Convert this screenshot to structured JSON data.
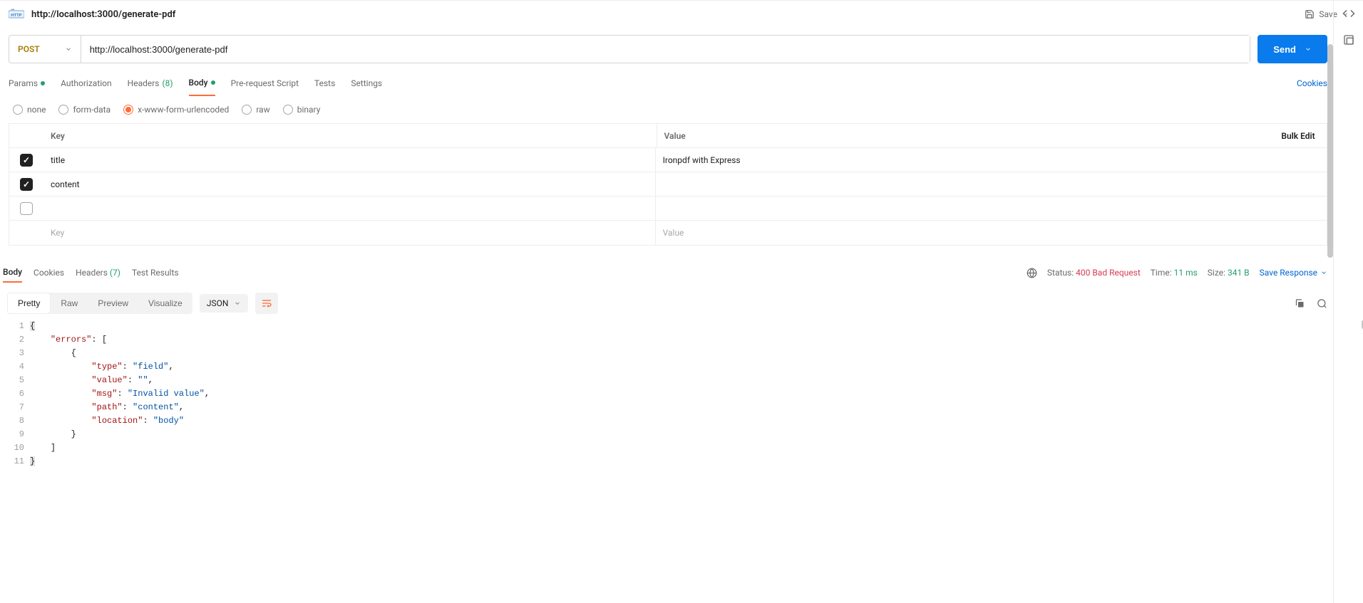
{
  "header": {
    "title": "http://localhost:3000/generate-pdf",
    "save_label": "Save"
  },
  "url_bar": {
    "method": "POST",
    "url": "http://localhost:3000/generate-pdf",
    "send_label": "Send"
  },
  "req_tabs": {
    "params": "Params",
    "authorization": "Authorization",
    "headers": "Headers",
    "headers_count": "(8)",
    "body": "Body",
    "prerequest": "Pre-request Script",
    "tests": "Tests",
    "settings": "Settings",
    "cookies": "Cookies"
  },
  "body_types": {
    "none": "none",
    "form_data": "form-data",
    "urlencoded": "x-www-form-urlencoded",
    "raw": "raw",
    "binary": "binary",
    "selected": "urlencoded"
  },
  "params_table": {
    "header_key": "Key",
    "header_value": "Value",
    "bulk_edit": "Bulk Edit",
    "rows": [
      {
        "checked": true,
        "key": "title",
        "value": "Ironpdf with Express"
      },
      {
        "checked": true,
        "key": "content",
        "value": ""
      },
      {
        "checked": false,
        "key": "",
        "value": ""
      }
    ],
    "placeholder_key": "Key",
    "placeholder_value": "Value"
  },
  "resp_tabs": {
    "body": "Body",
    "cookies": "Cookies",
    "headers": "Headers",
    "headers_count": "(7)",
    "test_results": "Test Results"
  },
  "resp_status": {
    "status_label": "Status:",
    "status_value": "400 Bad Request",
    "time_label": "Time:",
    "time_value": "11 ms",
    "size_label": "Size:",
    "size_value": "341 B",
    "save_response": "Save Response"
  },
  "resp_toolbar": {
    "pretty": "Pretty",
    "raw": "Raw",
    "preview": "Preview",
    "visualize": "Visualize",
    "format": "JSON"
  },
  "response_json": {
    "lines": [
      {
        "n": 1,
        "html": "<span class='hilite tok-punc'>{</span>"
      },
      {
        "n": 2,
        "html": "    <span class='tok-key'>\"errors\"</span><span class='tok-punc'>:</span> <span class='tok-punc'>[</span>"
      },
      {
        "n": 3,
        "html": "        <span class='tok-punc'>{</span>"
      },
      {
        "n": 4,
        "html": "            <span class='tok-key'>\"type\"</span><span class='tok-punc'>:</span> <span class='tok-str'>\"field\"</span><span class='tok-punc'>,</span>"
      },
      {
        "n": 5,
        "html": "            <span class='tok-key'>\"value\"</span><span class='tok-punc'>:</span> <span class='tok-str'>\"\"</span><span class='tok-punc'>,</span>"
      },
      {
        "n": 6,
        "html": "            <span class='tok-key'>\"msg\"</span><span class='tok-punc'>:</span> <span class='tok-str'>\"Invalid value\"</span><span class='tok-punc'>,</span>"
      },
      {
        "n": 7,
        "html": "            <span class='tok-key'>\"path\"</span><span class='tok-punc'>:</span> <span class='tok-str'>\"content\"</span><span class='tok-punc'>,</span>"
      },
      {
        "n": 8,
        "html": "            <span class='tok-key'>\"location\"</span><span class='tok-punc'>:</span> <span class='tok-str'>\"body\"</span>"
      },
      {
        "n": 9,
        "html": "        <span class='tok-punc'>}</span>"
      },
      {
        "n": 10,
        "html": "    <span class='tok-punc'>]</span>"
      },
      {
        "n": 11,
        "html": "<span class='hilite tok-punc'>}</span>"
      }
    ]
  }
}
